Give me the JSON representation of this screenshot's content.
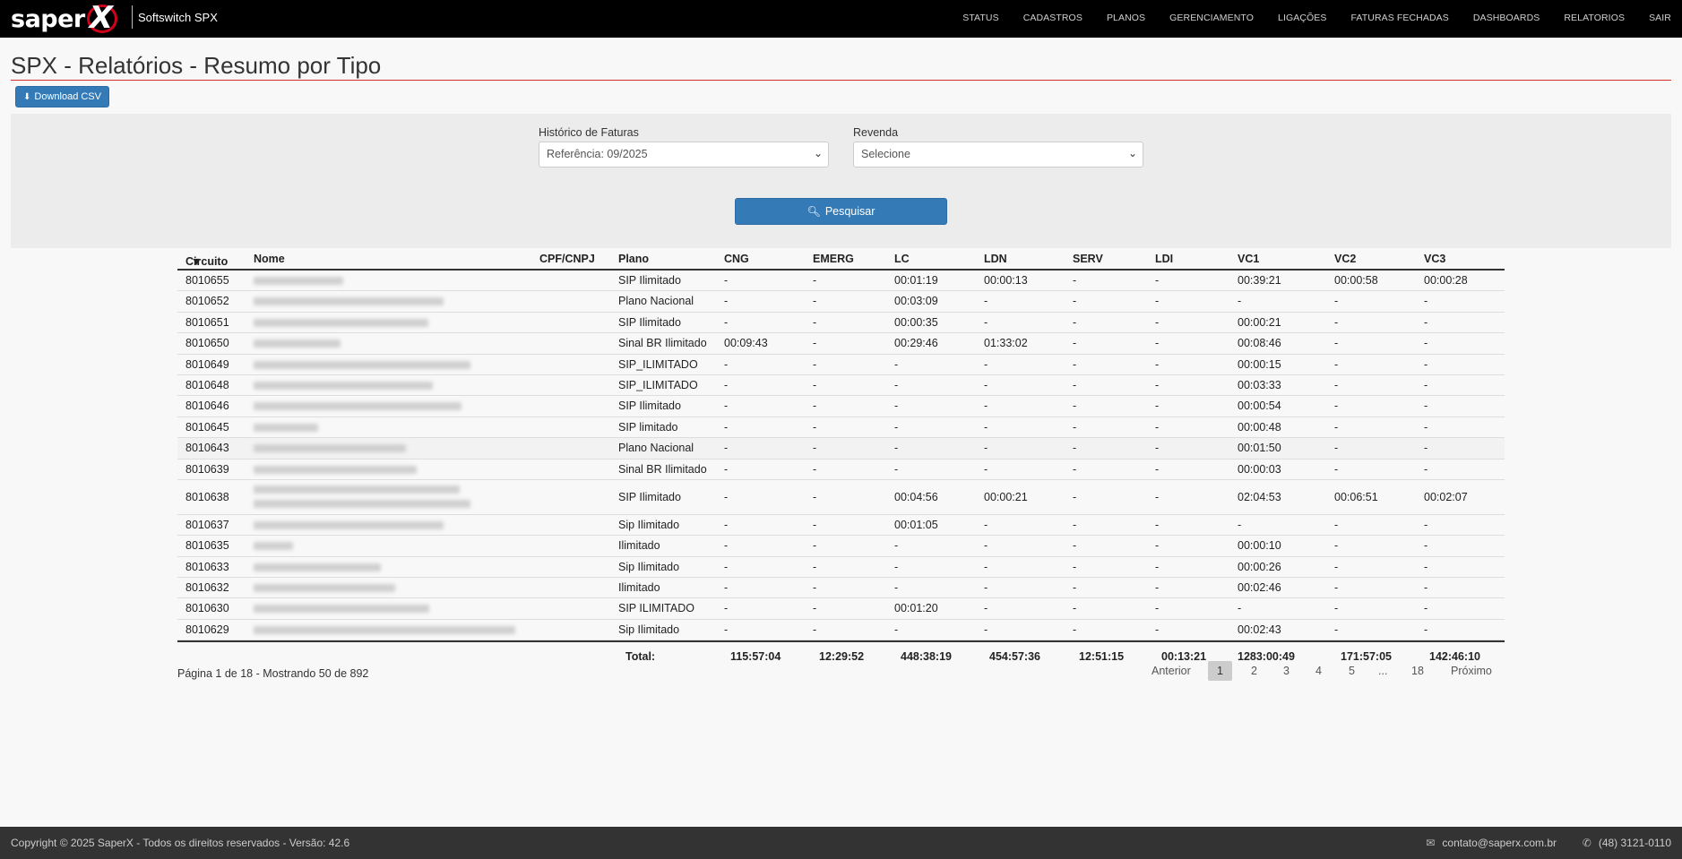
{
  "brand": {
    "logo_text": "saper",
    "logo_mark": "X",
    "app_name": "Softswitch SPX"
  },
  "nav": [
    "STATUS",
    "CADASTROS",
    "PLANOS",
    "GERENCIAMENTO",
    "LIGAÇÕES",
    "FATURAS FECHADAS",
    "DASHBOARDS",
    "RELATORIOS",
    "SAIR"
  ],
  "page": {
    "title": "SPX - Relatórios - Resumo por Tipo",
    "download_label": "Download CSV"
  },
  "filters": {
    "historico_label": "Histórico de Faturas",
    "historico_value": "Referência: 09/2025",
    "revenda_label": "Revenda",
    "revenda_value": "Selecione",
    "search_label": "Pesquisar"
  },
  "table": {
    "columns": [
      "Circuito",
      "Nome",
      "CPF/CNPJ",
      "Plano",
      "CNG",
      "EMERG",
      "LC",
      "LDN",
      "SERV",
      "LDI",
      "VC1",
      "VC2",
      "VC3"
    ],
    "rows": [
      {
        "circuito": "8010655",
        "plano": "SIP Ilimitado",
        "cng": "-",
        "emerg": "-",
        "lc": "00:01:19",
        "ldn": "00:00:13",
        "serv": "-",
        "ldi": "-",
        "vc1": "00:39:21",
        "vc2": "00:00:58",
        "vc3": "00:00:28"
      },
      {
        "circuito": "8010652",
        "plano": "Plano Nacional",
        "cng": "-",
        "emerg": "-",
        "lc": "00:03:09",
        "ldn": "-",
        "serv": "-",
        "ldi": "-",
        "vc1": "-",
        "vc2": "-",
        "vc3": "-"
      },
      {
        "circuito": "8010651",
        "plano": "SIP Ilimitado",
        "cng": "-",
        "emerg": "-",
        "lc": "00:00:35",
        "ldn": "-",
        "serv": "-",
        "ldi": "-",
        "vc1": "00:00:21",
        "vc2": "-",
        "vc3": "-"
      },
      {
        "circuito": "8010650",
        "plano": "Sinal BR Ilimitado",
        "cng": "00:09:43",
        "emerg": "-",
        "lc": "00:29:46",
        "ldn": "01:33:02",
        "serv": "-",
        "ldi": "-",
        "vc1": "00:08:46",
        "vc2": "-",
        "vc3": "-"
      },
      {
        "circuito": "8010649",
        "plano": "SIP_ILIMITADO",
        "cng": "-",
        "emerg": "-",
        "lc": "-",
        "ldn": "-",
        "serv": "-",
        "ldi": "-",
        "vc1": "00:00:15",
        "vc2": "-",
        "vc3": "-"
      },
      {
        "circuito": "8010648",
        "plano": "SIP_ILIMITADO",
        "cng": "-",
        "emerg": "-",
        "lc": "-",
        "ldn": "-",
        "serv": "-",
        "ldi": "-",
        "vc1": "00:03:33",
        "vc2": "-",
        "vc3": "-"
      },
      {
        "circuito": "8010646",
        "plano": "SIP Ilimitado",
        "cng": "-",
        "emerg": "-",
        "lc": "-",
        "ldn": "-",
        "serv": "-",
        "ldi": "-",
        "vc1": "00:00:54",
        "vc2": "-",
        "vc3": "-"
      },
      {
        "circuito": "8010645",
        "plano": "SIP limitado",
        "cng": "-",
        "emerg": "-",
        "lc": "-",
        "ldn": "-",
        "serv": "-",
        "ldi": "-",
        "vc1": "00:00:48",
        "vc2": "-",
        "vc3": "-"
      },
      {
        "circuito": "8010643",
        "plano": "Plano Nacional",
        "cng": "-",
        "emerg": "-",
        "lc": "-",
        "ldn": "-",
        "serv": "-",
        "ldi": "-",
        "vc1": "00:01:50",
        "vc2": "-",
        "vc3": "-"
      },
      {
        "circuito": "8010639",
        "plano": "Sinal BR Ilimitado",
        "cng": "-",
        "emerg": "-",
        "lc": "-",
        "ldn": "-",
        "serv": "-",
        "ldi": "-",
        "vc1": "00:00:03",
        "vc2": "-",
        "vc3": "-"
      },
      {
        "circuito": "8010638",
        "plano": "SIP Ilimitado",
        "cng": "-",
        "emerg": "-",
        "lc": "00:04:56",
        "ldn": "00:00:21",
        "serv": "-",
        "ldi": "-",
        "vc1": "02:04:53",
        "vc2": "00:06:51",
        "vc3": "00:02:07"
      },
      {
        "circuito": "8010637",
        "plano": "Sip Ilimitado",
        "cng": "-",
        "emerg": "-",
        "lc": "00:01:05",
        "ldn": "-",
        "serv": "-",
        "ldi": "-",
        "vc1": "-",
        "vc2": "-",
        "vc3": "-"
      },
      {
        "circuito": "8010635",
        "plano": "Ilimitado",
        "cng": "-",
        "emerg": "-",
        "lc": "-",
        "ldn": "-",
        "serv": "-",
        "ldi": "-",
        "vc1": "00:00:10",
        "vc2": "-",
        "vc3": "-"
      },
      {
        "circuito": "8010633",
        "plano": "Sip Ilimitado",
        "cng": "-",
        "emerg": "-",
        "lc": "-",
        "ldn": "-",
        "serv": "-",
        "ldi": "-",
        "vc1": "00:00:26",
        "vc2": "-",
        "vc3": "-"
      },
      {
        "circuito": "8010632",
        "plano": "Ilimitado",
        "cng": "-",
        "emerg": "-",
        "lc": "-",
        "ldn": "-",
        "serv": "-",
        "ldi": "-",
        "vc1": "00:02:46",
        "vc2": "-",
        "vc3": "-"
      },
      {
        "circuito": "8010630",
        "plano": "SIP ILIMITADO",
        "cng": "-",
        "emerg": "-",
        "lc": "00:01:20",
        "ldn": "-",
        "serv": "-",
        "ldi": "-",
        "vc1": "-",
        "vc2": "-",
        "vc3": "-"
      },
      {
        "circuito": "8010629",
        "plano": "Sip Ilimitado",
        "cng": "-",
        "emerg": "-",
        "lc": "-",
        "ldn": "-",
        "serv": "-",
        "ldi": "-",
        "vc1": "00:02:43",
        "vc2": "-",
        "vc3": "-"
      }
    ],
    "totals": {
      "label": "Total:",
      "cng": "115:57:04",
      "emerg": "12:29:52",
      "lc": "448:38:19",
      "ldn": "454:57:36",
      "serv": "12:51:15",
      "ldi": "00:13:21",
      "vc1": "1283:00:49",
      "vc2": "171:57:05",
      "vc3": "142:46:10"
    }
  },
  "pagination": {
    "info": "Página 1 de 18 - Mostrando 50 de 892",
    "prev": "Anterior",
    "pages": [
      "1",
      "2",
      "3",
      "4",
      "5",
      "...",
      "18"
    ],
    "next": "Próximo"
  },
  "footer": {
    "copyright": "Copyright © 2025 SaperX - Todos os direitos reservados - Versão: 42.6",
    "email": "contato@saperx.com.br",
    "phone": "(48) 3121-0110"
  }
}
